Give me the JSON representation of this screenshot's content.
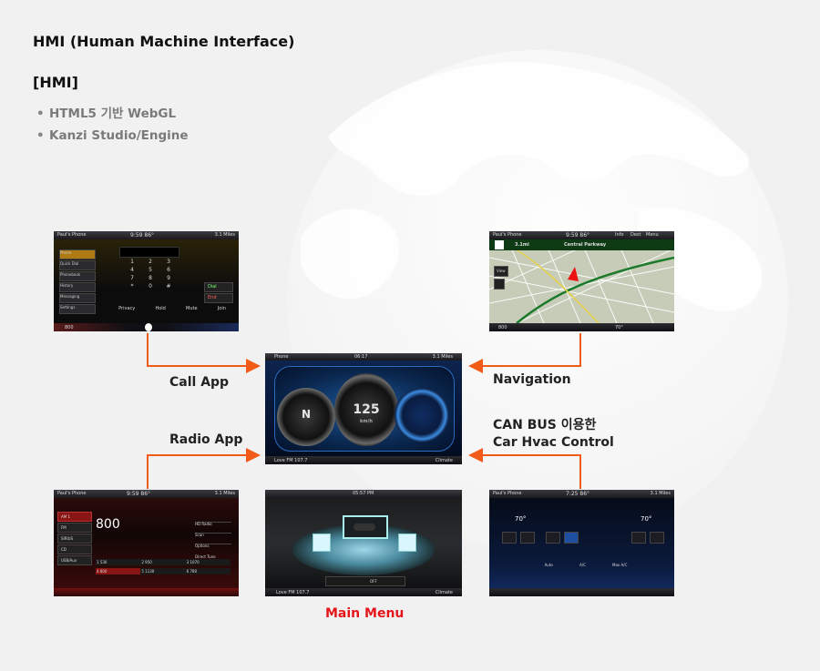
{
  "header": {
    "title": "HMI (Human Machine Interface)",
    "section": "[HMI]",
    "bullets": [
      "HTML5 기반 WebGL",
      "Kanzi Studio/Engine"
    ]
  },
  "labels": {
    "call_app": "Call App",
    "navigation": "Navigation",
    "radio_app": "Radio App",
    "can_bus_line1": "CAN BUS 이용한",
    "can_bus_line2": "Car Hvac Control",
    "main_menu": "Main Menu"
  },
  "screens": {
    "phone": {
      "status_name": "Paul's Phone",
      "time": "9:59 86°",
      "distance": "3.1 Miles",
      "menu": [
        "Phone",
        "Quick Dial",
        "Phonebook",
        "History",
        "Messaging",
        "Settings"
      ],
      "keys": [
        "1",
        "2",
        "3",
        "4",
        "5",
        "6",
        "7",
        "8",
        "9",
        "*",
        "0",
        "#"
      ],
      "actions": [
        "Dial",
        "End"
      ],
      "bottom_tabs": [
        "Privacy",
        "Hold",
        "Mute",
        "Join"
      ],
      "bottom_left": "800"
    },
    "navigation": {
      "status_name": "Paul's Phone",
      "time": "9:59 86°",
      "top_buttons": [
        "Info",
        "Dest",
        "Menu"
      ],
      "turn_distance": "3.1mi",
      "street": "Central Parkway",
      "view": "View",
      "bottom_left": "800",
      "temp": "70°"
    },
    "main": {
      "status_left": "Phone",
      "time": "06:17",
      "status_right": "3.1 Miles",
      "gauge_left": "N",
      "gauge_center": "125",
      "gauge_unit": "km/h",
      "bottom_left": "Love FM 107.7",
      "bottom_right": "Climate"
    },
    "radio": {
      "status_name": "Paul's Phone",
      "time": "9:59 86°",
      "distance": "3.1 Miles",
      "freq": "800",
      "sources": [
        "AM 1",
        "FM",
        "SIRIUS",
        "CD",
        "USB/Aux"
      ],
      "right_menu": [
        "HD Radio",
        "Scan",
        "Options",
        "Direct Tune"
      ],
      "presets": [
        "1 530",
        "2 950",
        "3 1070",
        "4 800",
        "5 1130",
        "6 780"
      ]
    },
    "main_menu": {
      "time": "05:57 PM",
      "bottom_left": "Love FM 107.7",
      "bottom_right": "Climate",
      "toolbar": [
        "OFF"
      ]
    },
    "climate": {
      "status_name": "Paul's Phone",
      "time": "7:25 86°",
      "distance": "3.1 Miles",
      "left_temp": "70°",
      "right_temp": "70°",
      "buttons": [
        "Auto",
        "A/C",
        "Max A/C"
      ]
    }
  },
  "colors": {
    "arrow": "#f25a18",
    "main_menu_label": "#e5161b",
    "bullet_text": "#7a7a7a"
  }
}
